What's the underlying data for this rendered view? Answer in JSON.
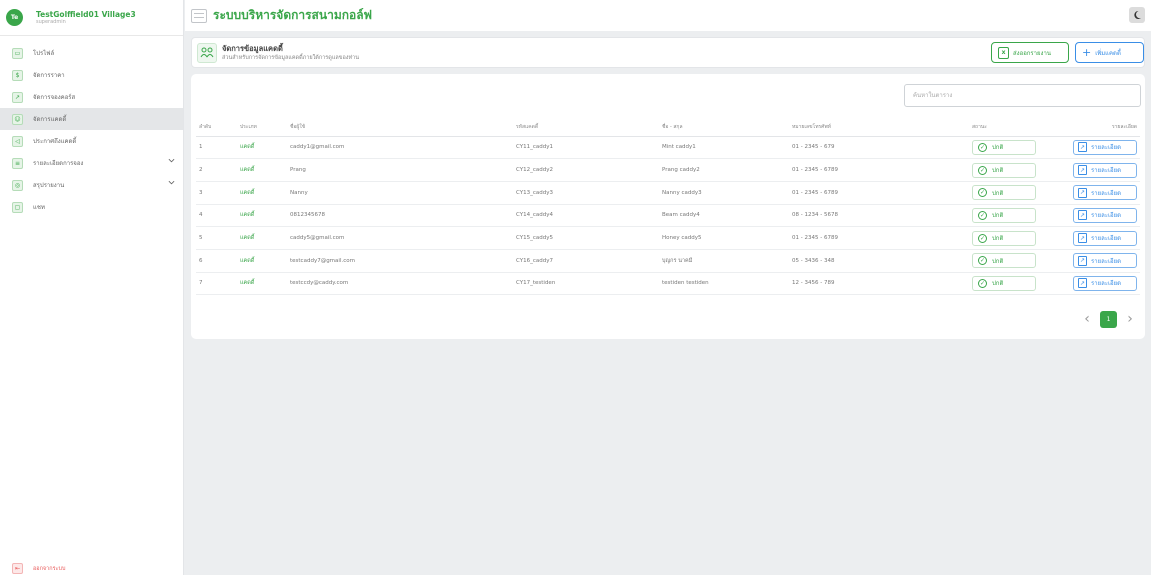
{
  "colors": {
    "accent": "#3aa64a",
    "link": "#3a8ee6",
    "danger": "#e85a5a"
  },
  "user": {
    "initials": "Te",
    "name": "TestGolffield01 Village3",
    "role": "superadmin"
  },
  "sidebar": {
    "items": [
      {
        "label": "โปรไฟล์",
        "icon": "id-card-icon",
        "glyph": "▭",
        "active": false,
        "chevron": false
      },
      {
        "label": "จัดการราคา",
        "icon": "coin-icon",
        "glyph": "$",
        "active": false,
        "chevron": false
      },
      {
        "label": "จัดการจองคอร์ส",
        "icon": "chart-icon",
        "glyph": "↗",
        "active": false,
        "chevron": false
      },
      {
        "label": "จัดการแคดดี้",
        "icon": "users-icon",
        "glyph": "☺",
        "active": true,
        "chevron": false
      },
      {
        "label": "ประกาศถึงแคดดี้",
        "icon": "megaphone-icon",
        "glyph": "◁",
        "active": false,
        "chevron": false
      },
      {
        "label": "รายละเอียดการจอง",
        "icon": "list-icon",
        "glyph": "≡",
        "active": false,
        "chevron": true
      },
      {
        "label": "สรุปรายงาน",
        "icon": "database-icon",
        "glyph": "◎",
        "active": false,
        "chevron": true
      },
      {
        "label": "แชท",
        "icon": "chat-icon",
        "glyph": "▢",
        "active": false,
        "chevron": false
      }
    ],
    "logout": "ออกจากระบบ"
  },
  "header": {
    "title": "ระบบบริหารจัดการสนามกอล์ฟ"
  },
  "page": {
    "title": "จัดการข้อมูลแคดดี้",
    "subtitle": "ส่วนสำหรับการจัดการข้อมูลแคดดี้ภายใต้การดูแลของท่าน",
    "export_label": "ส่งออกรายงาน",
    "add_label": "เพิ่มแคดดี้"
  },
  "search": {
    "placeholder": "ค้นหาในตาราง"
  },
  "table": {
    "headers": [
      "ลำดับ",
      "ประเภท",
      "ชื่อผู้ใช้",
      "รหัสแคดดี้",
      "ชื่อ - สกุล",
      "หมายเลขโทรศัพท์",
      "สถานะ",
      "รายละเอียด"
    ],
    "rows": [
      {
        "no": "1",
        "type": "แคดดี้",
        "username": "caddy1@gmail.com",
        "code": "CY11_caddy1",
        "fullname": "Mint caddy1",
        "phone": "01 - 2345 - 679",
        "status": "ปกติ",
        "detail": "รายละเอียด"
      },
      {
        "no": "2",
        "type": "แคดดี้",
        "username": "Prang",
        "code": "CY12_caddy2",
        "fullname": "Prang caddy2",
        "phone": "01 - 2345 - 6789",
        "status": "ปกติ",
        "detail": "รายละเอียด"
      },
      {
        "no": "3",
        "type": "แคดดี้",
        "username": "Nanny",
        "code": "CY13_caddy3",
        "fullname": "Nanny caddy3",
        "phone": "01 - 2345 - 6789",
        "status": "ปกติ",
        "detail": "รายละเอียด"
      },
      {
        "no": "4",
        "type": "แคดดี้",
        "username": "0812345678",
        "code": "CY14_caddy4",
        "fullname": "Beam caddy4",
        "phone": "08 - 1234 - 5678",
        "status": "ปกติ",
        "detail": "รายละเอียด"
      },
      {
        "no": "5",
        "type": "แคดดี้",
        "username": "caddy5@gmail.com",
        "code": "CY15_caddy5",
        "fullname": "Honey caddy5",
        "phone": "01 - 2345 - 6789",
        "status": "ปกติ",
        "detail": "รายละเอียด"
      },
      {
        "no": "6",
        "type": "แคดดี้",
        "username": "testcaddy7@gmail.com",
        "code": "CY16_caddy7",
        "fullname": "บุญกร นาคมี",
        "phone": "05 - 3436 - 348",
        "status": "ปกติ",
        "detail": "รายละเอียด"
      },
      {
        "no": "7",
        "type": "แคดดี้",
        "username": "testccdy@caddy.com",
        "code": "CY17_testiden",
        "fullname": "testiden testiden",
        "phone": "12 - 3456 - 789",
        "status": "ปกติ",
        "detail": "รายละเอียด"
      }
    ]
  },
  "pagination": {
    "current": "1",
    "prev": "‹",
    "next": "›"
  }
}
